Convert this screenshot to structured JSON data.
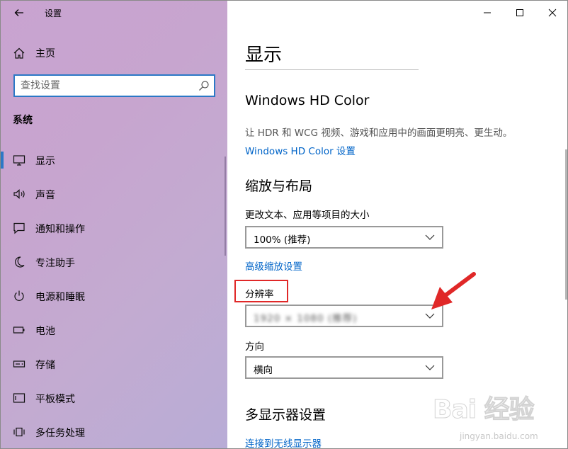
{
  "app": {
    "title": "设置"
  },
  "sidebar": {
    "home_label": "主页",
    "search_placeholder": "查找设置",
    "section": "系统",
    "items": [
      {
        "label": "显示",
        "icon": "monitor-icon",
        "active": true
      },
      {
        "label": "声音",
        "icon": "speaker-icon"
      },
      {
        "label": "通知和操作",
        "icon": "notification-icon"
      },
      {
        "label": "专注助手",
        "icon": "moon-icon"
      },
      {
        "label": "电源和睡眠",
        "icon": "power-icon"
      },
      {
        "label": "电池",
        "icon": "battery-icon"
      },
      {
        "label": "存储",
        "icon": "storage-icon"
      },
      {
        "label": "平板模式",
        "icon": "tablet-icon"
      },
      {
        "label": "多任务处理",
        "icon": "multitask-icon"
      }
    ]
  },
  "main": {
    "title": "显示",
    "hdr": {
      "heading": "Windows HD Color",
      "description": "让 HDR 和 WCG 视频、游戏和应用中的画面更明亮、更生动。",
      "link": "Windows HD Color 设置"
    },
    "scale": {
      "heading": "缩放与布局",
      "scale_label": "更改文本、应用等项目的大小",
      "scale_value": "100% (推荐)",
      "advanced_link": "高级缩放设置",
      "resolution_label": "分辨率",
      "resolution_value": "1920 × 1080 (推荐)",
      "orientation_label": "方向",
      "orientation_value": "横向"
    },
    "multi": {
      "heading": "多显示器设置",
      "link": "连接到无线显示器"
    }
  },
  "watermark": {
    "brand": "Bai 经验",
    "url": "jingyan.baidu.com"
  },
  "colors": {
    "accent": "#2b78c6",
    "link": "#0064c8",
    "highlight": "#e02828"
  }
}
